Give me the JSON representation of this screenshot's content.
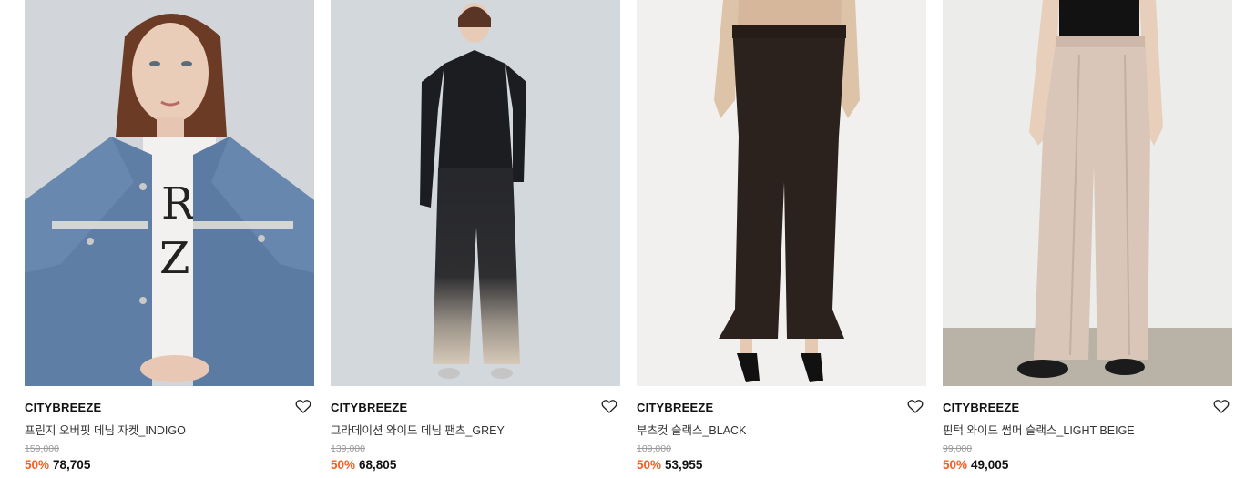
{
  "products": [
    {
      "brand": "CITYBREEZE",
      "name": "프린지 오버핏 데님 자켓_INDIGO",
      "original_price": "159,000",
      "discount": "50%",
      "sale_price": "78,705",
      "image_icon": "denim-jacket-photo"
    },
    {
      "brand": "CITYBREEZE",
      "name": "그라데이션 와이드 데님 팬츠_GREY",
      "original_price": "139,000",
      "discount": "50%",
      "sale_price": "68,805",
      "image_icon": "gradient-denim-pants-photo"
    },
    {
      "brand": "CITYBREEZE",
      "name": "부츠컷 슬랙스_BLACK",
      "original_price": "109,000",
      "discount": "50%",
      "sale_price": "53,955",
      "image_icon": "bootcut-slacks-photo"
    },
    {
      "brand": "CITYBREEZE",
      "name": "핀턱 와이드 썸머 슬랙스_LIGHT BEIGE",
      "original_price": "99,000",
      "discount": "50%",
      "sale_price": "49,005",
      "image_icon": "wide-slacks-photo"
    }
  ],
  "colors": {
    "discount": "#ff5a1f",
    "original_price": "#9a9a9a",
    "brand": "#111111"
  },
  "icons": {
    "wishlist": "heart-outline-icon"
  }
}
